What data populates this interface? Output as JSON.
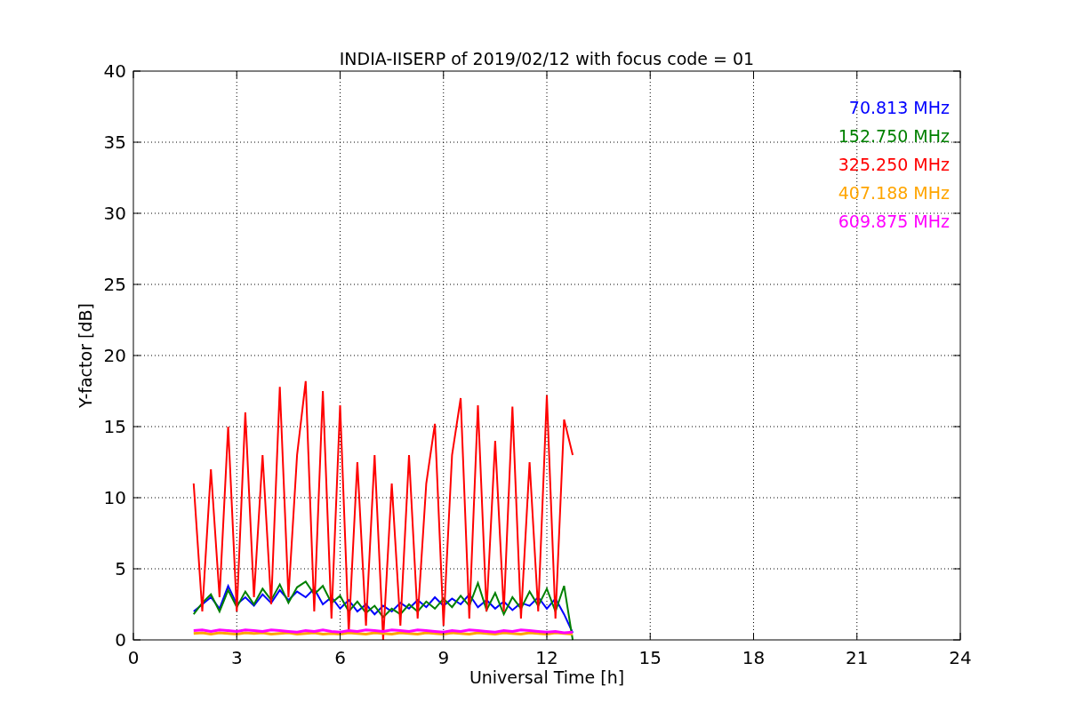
{
  "chart_data": {
    "type": "line",
    "title": "INDIA-IISERP of 2019/02/12 with focus code = 01",
    "xlabel": "Universal Time [h]",
    "ylabel": "Y-factor [dB]",
    "x": [
      1.75,
      2,
      2.25,
      2.5,
      2.75,
      3,
      3.25,
      3.5,
      3.75,
      4,
      4.25,
      4.5,
      4.75,
      5,
      5.25,
      5.5,
      5.75,
      6,
      6.25,
      6.5,
      6.75,
      7,
      7.25,
      7.5,
      7.75,
      8,
      8.25,
      8.5,
      8.75,
      9,
      9.25,
      9.5,
      9.75,
      10,
      10.25,
      10.5,
      10.75,
      11,
      11.25,
      11.5,
      11.75,
      12,
      12.25,
      12.5,
      12.75
    ],
    "series": [
      {
        "name": "70.813 MHz",
        "color": "#0000ff",
        "values": [
          2,
          2.5,
          3,
          2.2,
          3.8,
          2.5,
          3,
          2.4,
          3.2,
          2.6,
          3.5,
          2.8,
          3.4,
          3,
          3.6,
          2.5,
          3,
          2.2,
          2.8,
          2,
          2.5,
          1.8,
          2.4,
          2,
          2.6,
          2.2,
          2.8,
          2.3,
          3,
          2.4,
          2.9,
          2.5,
          3.2,
          2.3,
          2.8,
          2.2,
          2.7,
          2.1,
          2.6,
          2.4,
          3,
          2.2,
          2.9,
          1.8,
          0.5
        ]
      },
      {
        "name": "152.750 MHz",
        "color": "#008000",
        "values": [
          1.8,
          2.6,
          3.2,
          2,
          3.5,
          2.3,
          3.4,
          2.5,
          3.6,
          2.8,
          3.9,
          2.6,
          3.7,
          4.1,
          3.2,
          3.8,
          2.6,
          3.1,
          2,
          2.7,
          1.9,
          2.4,
          1.6,
          2.2,
          1.8,
          2.5,
          2,
          2.7,
          2.2,
          2.9,
          2.3,
          3.1,
          2.4,
          4,
          2.1,
          3.3,
          1.8,
          3,
          2.2,
          3.4,
          2.4,
          3.6,
          2,
          3.8,
          0
        ]
      },
      {
        "name": "325.250 MHz",
        "color": "#ff0000",
        "values": [
          11,
          2,
          12,
          3,
          15,
          2,
          16,
          3,
          13,
          2.5,
          17.8,
          3,
          13,
          18.2,
          2,
          17.5,
          1.5,
          16.5,
          0.5,
          12.5,
          1,
          13,
          0,
          11,
          1,
          13,
          1.5,
          11,
          15.2,
          1,
          13,
          17,
          1.5,
          16.5,
          2,
          14,
          2,
          16.4,
          1.5,
          12.5,
          2,
          17.2,
          1.5,
          15.5,
          13
        ]
      },
      {
        "name": "407.188 MHz",
        "color": "#ffa500",
        "values": [
          0.45,
          0.5,
          0.4,
          0.5,
          0.45,
          0.4,
          0.5,
          0.45,
          0.5,
          0.4,
          0.45,
          0.5,
          0.4,
          0.45,
          0.5,
          0.4,
          0.45,
          0.4,
          0.5,
          0.45,
          0.4,
          0.5,
          0.45,
          0.4,
          0.5,
          0.45,
          0.4,
          0.5,
          0.45,
          0.4,
          0.5,
          0.45,
          0.4,
          0.5,
          0.45,
          0.4,
          0.5,
          0.45,
          0.4,
          0.5,
          0.45,
          0.4,
          0.5,
          0.45,
          0.4
        ]
      },
      {
        "name": "609.875 MHz",
        "color": "#ff00ff",
        "values": [
          0.65,
          0.7,
          0.6,
          0.7,
          0.65,
          0.6,
          0.7,
          0.65,
          0.6,
          0.7,
          0.65,
          0.6,
          0.55,
          0.65,
          0.6,
          0.7,
          0.6,
          0.55,
          0.65,
          0.6,
          0.7,
          0.65,
          0.6,
          0.7,
          0.65,
          0.6,
          0.7,
          0.65,
          0.6,
          0.55,
          0.65,
          0.6,
          0.7,
          0.65,
          0.6,
          0.55,
          0.65,
          0.6,
          0.7,
          0.65,
          0.6,
          0.55,
          0.6,
          0.5,
          0.55
        ]
      }
    ],
    "grid": true,
    "xlim": [
      0,
      24
    ],
    "ylim": [
      0,
      40
    ],
    "xticks": [
      0,
      3,
      6,
      9,
      12,
      15,
      18,
      21,
      24
    ],
    "yticks": [
      0,
      5,
      10,
      15,
      20,
      25,
      30,
      35,
      40
    ]
  }
}
